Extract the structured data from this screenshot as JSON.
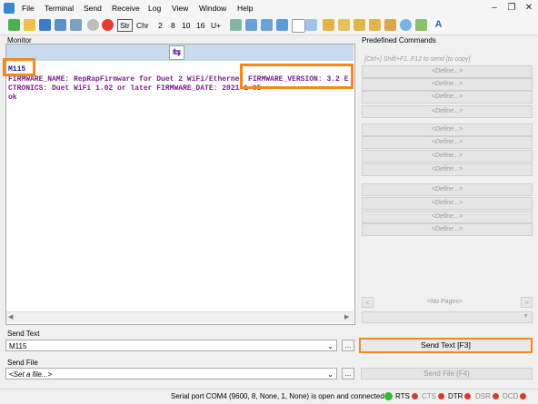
{
  "menu": {
    "items": [
      "File",
      "Terminal",
      "Send",
      "Receive",
      "Log",
      "View",
      "Window",
      "Help"
    ]
  },
  "toolbar": {
    "str_label": "Str",
    "chr_label": "Chr",
    "num_2": "2",
    "num_8": "8",
    "num_10": "10",
    "num_16": "16",
    "unicode_label": "U+"
  },
  "monitor": {
    "title": "Monitor",
    "lines": [
      "M115",
      "FIRMWARE_NAME: RepRapFirmware for Duet 2 WiFi/Ethernet FIRMWARE_VERSION: 3.2 E",
      "CTRONICS: Duet WiFi 1.02 or later FIRMWARE_DATE: 2021-1-05",
      "ok"
    ]
  },
  "predefined": {
    "title": "Predefined Commands",
    "hint": "[Ctrl+] Shift+F1..F12 to send [to copy]",
    "define_label": "<Define...>",
    "no_pages": "<No Pages>"
  },
  "send_text": {
    "title": "Send Text",
    "value": "M115",
    "browse": "...",
    "button": "Send Text [F3]"
  },
  "send_file": {
    "title": "Send File",
    "placeholder": "<Set a file...>",
    "browse": "...",
    "button": "Send File (F4)"
  },
  "status": {
    "port_text": "Serial port COM4 (9600, 8, None, 1, None) is open and connected",
    "signals": [
      "RTS",
      "CTS",
      "DTR",
      "DSR",
      "DCD"
    ],
    "colors": {
      "port_led": "#2dba2d",
      "signal_led": "#d63b2b",
      "highlight": "#f08a1c"
    }
  }
}
